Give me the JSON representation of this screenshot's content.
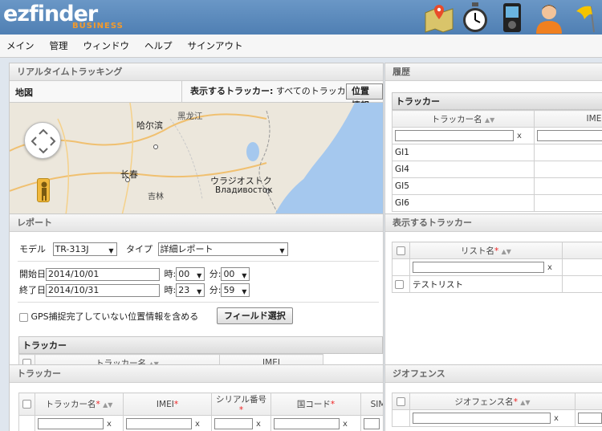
{
  "app": {
    "logo_main": "ezfinder",
    "logo_sub": "BUSINESS"
  },
  "menu": [
    "メイン",
    "管理",
    "ウィンドウ",
    "ヘルプ",
    "サインアウト"
  ],
  "realtime": {
    "title": "リアルタイムトラッキング",
    "map_label": "地図",
    "show_trackers_label": "表示するトラッカー:",
    "show_trackers_value": "すべてのトラッカー",
    "position_button": "位置情報",
    "map_places": [
      "黑龙江",
      "哈尔滨",
      "长春",
      "吉林",
      "ウラジオストク",
      "Владивосток"
    ]
  },
  "history": {
    "title": "履歴",
    "section": "トラッカー",
    "col_name": "トラッカー名",
    "col_imei": "IMEI",
    "rows": [
      "GI1",
      "GI4",
      "GI5",
      "GI6"
    ]
  },
  "report": {
    "title": "レポート",
    "model_label": "モデル",
    "model_value": "TR-313J",
    "type_label": "タイプ",
    "type_value": "詳細レポート",
    "start_label": "開始日",
    "start_date": "2014/10/01",
    "end_label": "終了日",
    "end_date": "2014/10/31",
    "hour_label": "時:",
    "min_label": "分:",
    "start_hour": "00",
    "start_min": "00",
    "end_hour": "23",
    "end_min": "59",
    "gps_checkbox": "GPS捕捉完了していない位置情報を含める",
    "field_button": "フィールド選択",
    "tracker_section": "トラッカー",
    "col_name": "トラッカー名",
    "col_imei": "IMEI"
  },
  "display_trackers": {
    "title": "表示するトラッカー",
    "col_list": "リスト名",
    "rows": [
      "テストリスト"
    ]
  },
  "trackers": {
    "title": "トラッカー",
    "cols": [
      "トラッカー名",
      "IMEI",
      "シリアル番号",
      "国コード",
      "SIM"
    ]
  },
  "geofence": {
    "title": "ジオフェンス",
    "col_name": "ジオフェンス名"
  },
  "colors": {
    "topbar": "#5b8bbd",
    "accent": "#f39a2b",
    "required": "#e22222"
  }
}
